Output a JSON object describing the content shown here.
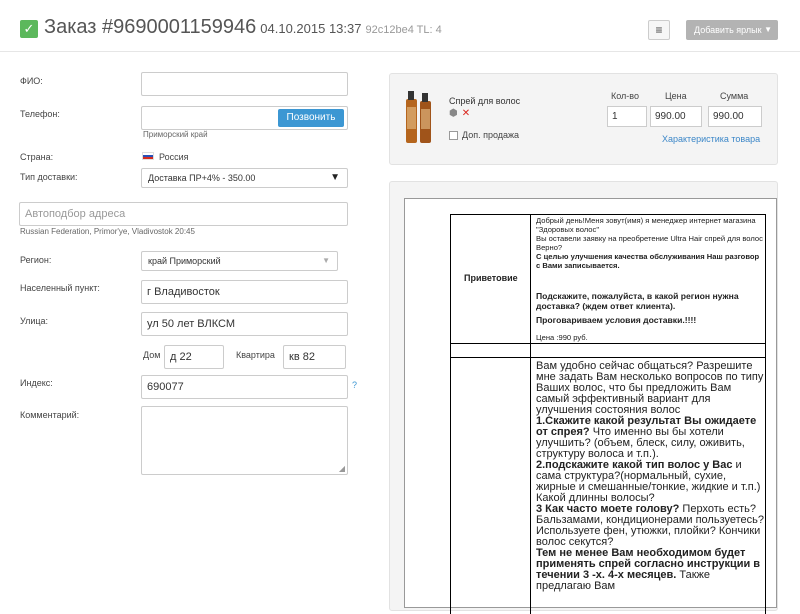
{
  "header": {
    "order_title": "Заказ #9690001159946",
    "datetime": "04.10.2015 13:37",
    "hash": "92c12be4 TL: 4",
    "check_icon": "check-icon",
    "menu_icon": "list-icon",
    "add_label_button": "Добавить ярлык"
  },
  "form": {
    "fio_label": "ФИО:",
    "fio_value": "",
    "phone_label": "Телефон:",
    "phone_value": "",
    "call_button": "Позвонить",
    "phone_region": "Приморский край",
    "country_label": "Страна:",
    "country_value": "Россия",
    "delivery_label": "Тип доставки:",
    "delivery_value": "Доставка ПР+4% - 350.00",
    "address_placeholder": "Автоподбор адреса",
    "address_hint": "Russian Federation, Primor'ye, Vladivostok 20:45",
    "region_label": "Регион:",
    "region_value": "край Приморский",
    "city_label": "Населенный пункт:",
    "city_value": "г Владивосток",
    "street_label": "Улица:",
    "street_value": "ул 50 лет ВЛКСМ",
    "house_label": "Дом",
    "house_value": "д 22",
    "flat_label": "Квартира",
    "flat_value": "кв 82",
    "index_label": "Индекс:",
    "index_value": "690077",
    "index_help": "?",
    "comment_label": "Комментарий:",
    "comment_value": ""
  },
  "product": {
    "name": "Спрей для волос",
    "extra_sale": "Доп. продажа",
    "qty_header": "Кол-во",
    "price_header": "Цена",
    "sum_header": "Сумма",
    "qty": "1",
    "price": "990.00",
    "sum": "990.00",
    "details_link": "Характеристика товара"
  },
  "script": {
    "greeting_label": "Приветовие",
    "greet_lines": [
      "Добрый день!Меня зовут(имя) я менеджер интернет магазина \"Здоровых волос\"",
      "Вы оставели заявку на преобретение Ultra Hair спрей для волос",
      "Верно?"
    ],
    "greet_bold_1": "С целью улучшения качества обслуживания Наш разговор с Вами записывается.",
    "greet_bold_2": "Подскажите, пожалуйста, в какой регион нужна доставка? (ждем ответ клиента).",
    "greet_bold_3": "Проговариваем условия доставки.!!!!",
    "greet_price": "Цена :990 руб.",
    "big_intro": "Вам удобно сейчас общаться? Разрешите мне задать Вам несколько вопросов по типу Ваших волос, что бы предложить Вам самый эффективный вариант для улучшения состояния волос",
    "q1_bold": "1.Скажите какой результат Вы ожидаете от спрея?",
    "q1_text": "Что именно вы бы хотели улучшить? (объем, блеск, силу, оживить, структуру волоса и т.п.).",
    "q2_bold": "2.подскажите какой тип волос у Вас",
    "q2_text": "и сама структура?(нормальный, сухие, жирные и смешанные/тонкие, жидкие и т.п.) Какой длинны волосы?",
    "q3_bold": "3 Как часто моете голову?",
    "q3_text": "Перхоть есть? Бальзамами, кондиционерами пользуетесь? Используете фен, утюжки, плойки? Кончики волос секутся?",
    "outro_bold": "Тем не менее Вам необходимом будет применять спрей согласно инструкции в течении 3 -х. 4-х месяцев.",
    "outro_text": "Также предлагаю Вам"
  }
}
